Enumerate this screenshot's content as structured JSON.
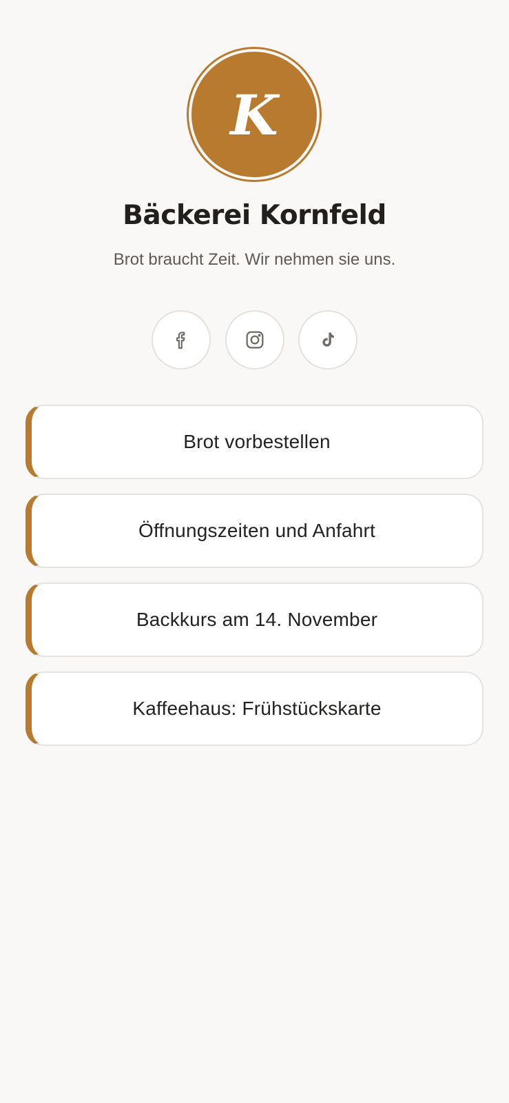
{
  "theme": {
    "accent": "#b87a2e",
    "background": "#f9f8f6"
  },
  "profile": {
    "initial": "K",
    "name": "Bäckerei Kornfeld",
    "tagline": "Brot braucht Zeit. Wir nehmen sie uns."
  },
  "socials": [
    {
      "icon": "facebook-icon"
    },
    {
      "icon": "instagram-icon"
    },
    {
      "icon": "tiktok-icon"
    }
  ],
  "links": [
    {
      "label": "Brot vorbestellen"
    },
    {
      "label": "Öffnungszeiten und Anfahrt"
    },
    {
      "label": "Backkurs am 14. November"
    },
    {
      "label": "Kaffeehaus: Frühstückskarte"
    }
  ]
}
